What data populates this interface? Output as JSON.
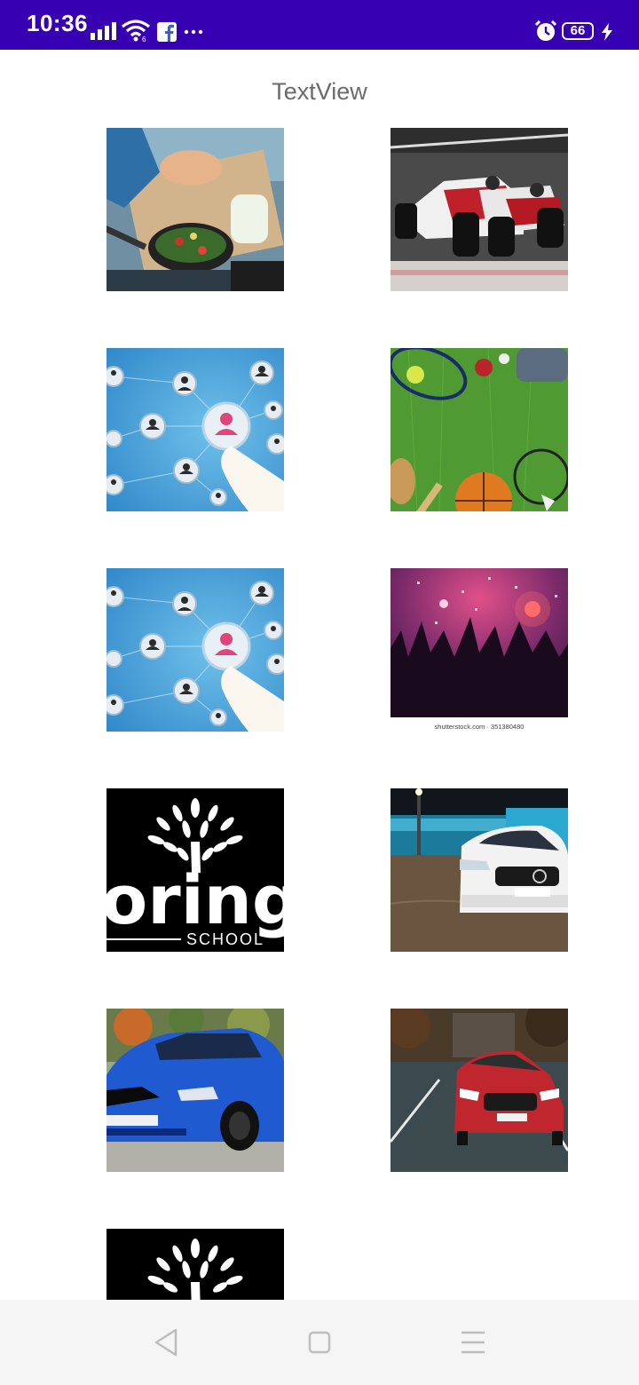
{
  "status_bar": {
    "time": "10:36",
    "battery": "66",
    "background": "#3700b3",
    "icons": [
      "signal-icon",
      "wifi-icon",
      "facebook-icon",
      "more-notifications-icon",
      "alarm-icon",
      "battery-icon",
      "charging-icon"
    ]
  },
  "title": "TextView",
  "grid": {
    "tiles": [
      {
        "name": "cooking-image"
      },
      {
        "name": "formula-e-racing-image"
      },
      {
        "name": "social-network-image"
      },
      {
        "name": "sports-equipment-image"
      },
      {
        "name": "social-network-image"
      },
      {
        "name": "concert-crowd-image",
        "caption": "shutterstock.com · 351380480"
      },
      {
        "name": "school-logo-image",
        "logo_text": "oring",
        "logo_sub": "SCHOOL"
      },
      {
        "name": "white-volvo-image"
      },
      {
        "name": "blue-bmw-image"
      },
      {
        "name": "red-volvo-image"
      },
      {
        "name": "school-logo-image"
      }
    ]
  },
  "nav_bar": {
    "buttons": [
      "back-button",
      "home-button",
      "menu-button"
    ]
  }
}
